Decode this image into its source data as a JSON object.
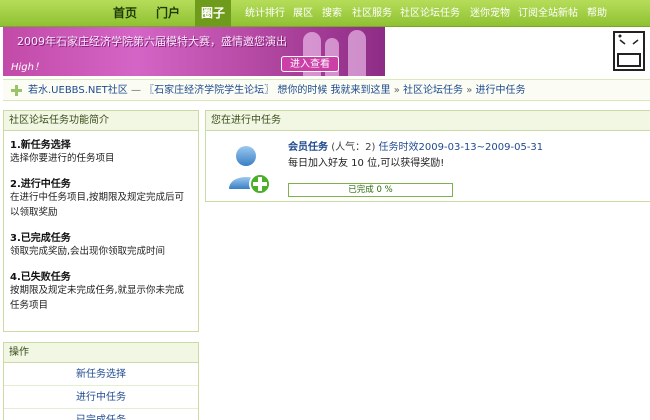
{
  "nav": {
    "main": [
      {
        "label": "首页",
        "name": "nav-home"
      },
      {
        "label": "门户",
        "name": "nav-portal"
      },
      {
        "label": "圈子",
        "name": "nav-circle"
      }
    ],
    "sub": [
      {
        "label": "统计排行",
        "name": "nav-stats"
      },
      {
        "label": "展区",
        "name": "nav-exhibition"
      },
      {
        "label": "搜索",
        "name": "nav-search"
      },
      {
        "label": "社区服务",
        "name": "nav-services"
      },
      {
        "label": "社区论坛任务",
        "name": "nav-tasks"
      },
      {
        "label": "迷你宠物",
        "name": "nav-pets"
      },
      {
        "label": "订阅全站新帖",
        "name": "nav-subscribe"
      },
      {
        "label": "帮助",
        "name": "nav-help"
      }
    ]
  },
  "banner": {
    "title": "2009年石家庄经济学院第六届模特大赛，盛情邀您演出",
    "high_text": "High！",
    "button": "进入查看"
  },
  "breadcrumb": {
    "site": "若水.UEBBS.NET社区",
    "dash": "—",
    "forum": "〖石家庄经济学院学生论坛〗",
    "slogan": "想你的时候 我就来到这里",
    "sep": "»",
    "section": "社区论坛任务",
    "current": "进行中任务"
  },
  "intro": {
    "header": "社区论坛任务功能简介",
    "items": [
      {
        "title": "1.新任务选择",
        "desc": "选择你要进行的任务项目"
      },
      {
        "title": "2.进行中任务",
        "desc": "在进行中任务项目,按期限及规定完成后可以领取奖励"
      },
      {
        "title": "3.已完成任务",
        "desc": "领取完成奖励,会出现你领取完成时间"
      },
      {
        "title": "4.已失败任务",
        "desc": "按期限及规定未完成任务,就显示你未完成任务项目"
      }
    ]
  },
  "operations": {
    "header": "操作",
    "items": [
      "新任务选择",
      "进行中任务",
      "已完成任务"
    ]
  },
  "task_panel": {
    "header": "您在进行中任务",
    "task": {
      "name": "会员任务",
      "popularity": "(人气：2)",
      "time_label": "任务时效",
      "time": "2009-03-13~2009-05-31",
      "desc": "每日加入好友 10 位,可以获得奖励!",
      "progress_label": "已完成 0 %",
      "progress_value": 0
    }
  }
}
